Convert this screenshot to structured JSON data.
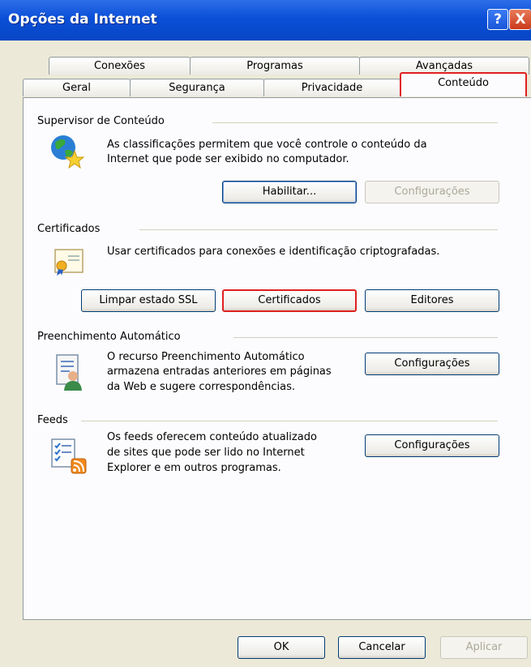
{
  "window": {
    "title": "Opções da Internet"
  },
  "title_buttons": {
    "help": "?",
    "close": "X"
  },
  "tabs": {
    "row1": [
      "Conexões",
      "Programas",
      "Avançadas"
    ],
    "row2": [
      "Geral",
      "Segurança",
      "Privacidade",
      "Conteúdo"
    ],
    "active": "Conteúdo"
  },
  "supervisor": {
    "title": "Supervisor de Conteúdo",
    "desc1": "As classificações permitem que você controle o conteúdo da",
    "desc2": "Internet que pode ser exibido no computador.",
    "enable_label": "Habilitar...",
    "settings_label": "Configurações"
  },
  "certificados": {
    "title": "Certificados",
    "desc": "Usar certificados para conexões e identificação criptografadas.",
    "clear_ssl_label": "Limpar estado SSL",
    "certs_label": "Certificados",
    "publishers_label": "Editores"
  },
  "autocomplete": {
    "title": "Preenchimento Automático",
    "desc1": "O recurso Preenchimento Automático",
    "desc2": "armazena entradas anteriores em páginas",
    "desc3": "da Web e sugere correspondências.",
    "settings_label": "Configurações"
  },
  "feeds": {
    "title": "Feeds",
    "desc1": "Os feeds oferecem conteúdo atualizado",
    "desc2": "de sites que pode ser lido no Internet",
    "desc3": "Explorer e em outros programas.",
    "settings_label": "Configurações"
  },
  "footer": {
    "ok_label": "OK",
    "cancel_label": "Cancelar",
    "apply_label": "Aplicar"
  },
  "icons": [
    "globe-star-icon",
    "certificate-icon",
    "autocomplete-icon",
    "feeds-icon"
  ],
  "colors": {
    "titlebar": "#0a4fd8",
    "highlight": "#e02020",
    "face": "#ece9d8"
  }
}
